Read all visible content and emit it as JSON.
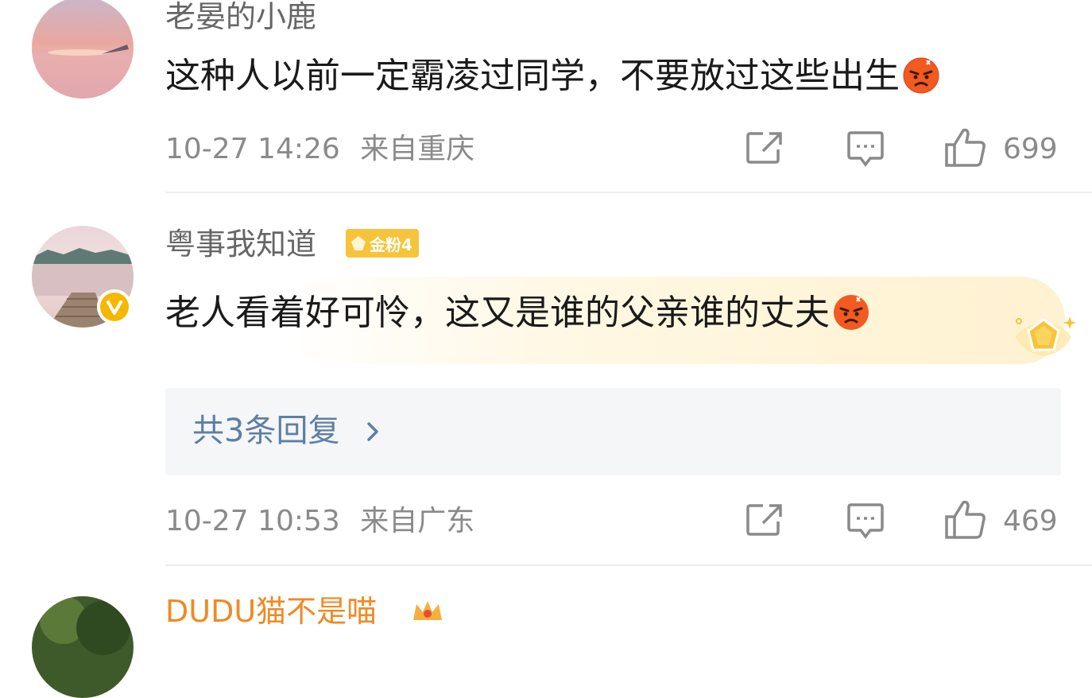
{
  "comments": [
    {
      "username": "老晏的小鹿",
      "text": "这种人以前一定霸凌过同学，不要放过这些出生",
      "emoji": "angry-face",
      "time": "10-27 14:26",
      "location": "来自重庆",
      "likes": "699"
    },
    {
      "username": "粤事我知道",
      "badge": "金粉4",
      "verified": true,
      "text": "老人看着好可怜，这又是谁的父亲谁的丈夫",
      "emoji": "angry-face",
      "replies_label": "共3条回复",
      "time": "10-27 10:53",
      "location": "来自广东",
      "likes": "469"
    },
    {
      "username": "DUDU猫不是喵"
    }
  ],
  "colors": {
    "username": "#666666",
    "text": "#1a1a1a",
    "meta": "#8a8a8a",
    "reply_link": "#5d7fa6",
    "badge": "#f6c43a",
    "verified": "#f5b800",
    "third_username": "#f08a24"
  },
  "icons": {
    "share": "share-icon",
    "comment": "comment-icon",
    "like": "thumbs-up-icon"
  }
}
